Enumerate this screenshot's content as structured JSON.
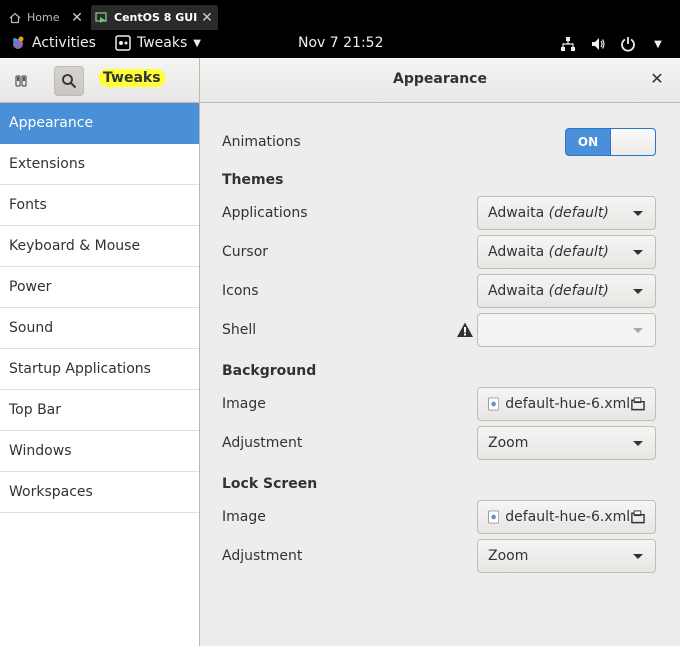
{
  "browser_tabs": [
    {
      "label": "Home",
      "icon": "home-icon"
    },
    {
      "label": "CentOS 8 GUI",
      "icon": "vm-icon"
    }
  ],
  "topbar": {
    "activities": "Activities",
    "app_menu": "Tweaks",
    "clock": "Nov 7  21:52"
  },
  "headerbar": {
    "app_title": "Tweaks",
    "page_title": "Appearance",
    "highlight_color": "#ffff33"
  },
  "sidebar": {
    "selected_color": "#4a90d9",
    "items": [
      {
        "label": "Appearance"
      },
      {
        "label": "Extensions"
      },
      {
        "label": "Fonts"
      },
      {
        "label": "Keyboard & Mouse"
      },
      {
        "label": "Power"
      },
      {
        "label": "Sound"
      },
      {
        "label": "Startup Applications"
      },
      {
        "label": "Top Bar"
      },
      {
        "label": "Windows"
      },
      {
        "label": "Workspaces"
      }
    ]
  },
  "content": {
    "animations": {
      "label": "Animations",
      "switch_label": "ON"
    },
    "themes": {
      "heading": "Themes",
      "applications": {
        "label": "Applications",
        "value": "Adwaita",
        "suffix": "(default)"
      },
      "cursor": {
        "label": "Cursor",
        "value": "Adwaita",
        "suffix": "(default)"
      },
      "icons": {
        "label": "Icons",
        "value": "Adwaita",
        "suffix": "(default)"
      },
      "shell": {
        "label": "Shell",
        "value": ""
      }
    },
    "background": {
      "heading": "Background",
      "image": {
        "label": "Image",
        "value": "default-hue-6.xml"
      },
      "adjustment": {
        "label": "Adjustment",
        "value": "Zoom"
      }
    },
    "lock_screen": {
      "heading": "Lock Screen",
      "image": {
        "label": "Image",
        "value": "default-hue-6.xml"
      },
      "adjustment": {
        "label": "Adjustment",
        "value": "Zoom"
      }
    }
  }
}
